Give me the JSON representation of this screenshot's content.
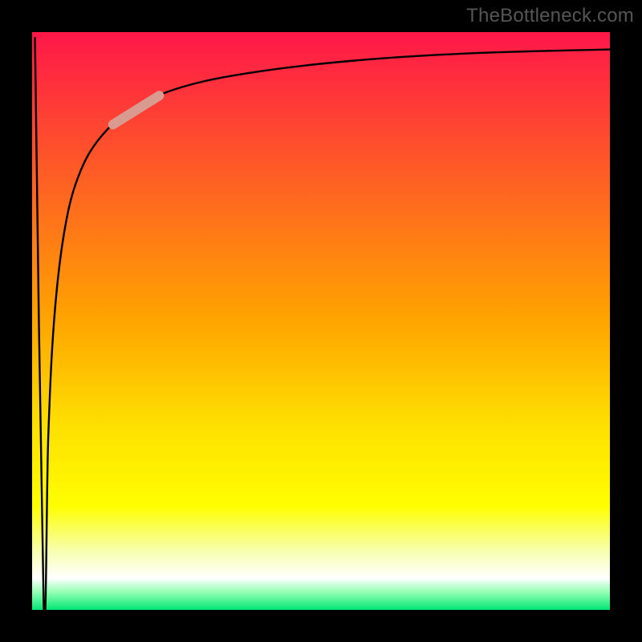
{
  "watermark": "TheBottleneck.com",
  "chart_data": {
    "type": "line",
    "title": "",
    "xlabel": "",
    "ylabel": "",
    "xlim": [
      0,
      100
    ],
    "ylim": [
      0,
      100
    ],
    "grid": false,
    "background_gradient": {
      "stops": [
        {
          "offset": 0,
          "color": "#fe1749"
        },
        {
          "offset": 0.5,
          "color": "#ffa500"
        },
        {
          "offset": 0.68,
          "color": "#fedf00"
        },
        {
          "offset": 0.82,
          "color": "#fffe00"
        },
        {
          "offset": 0.9,
          "color": "#f7ffb3"
        },
        {
          "offset": 0.945,
          "color": "#ffffff"
        },
        {
          "offset": 0.97,
          "color": "#90ffb0"
        },
        {
          "offset": 1,
          "color": "#00e676"
        }
      ]
    },
    "series": [
      {
        "name": "bottleneck-curve",
        "points": [
          {
            "x": 0.5,
            "y": 99.0
          },
          {
            "x": 2.0,
            "y": 1.0
          },
          {
            "x": 2.8,
            "y": 30.0
          },
          {
            "x": 3.8,
            "y": 50.0
          },
          {
            "x": 5.5,
            "y": 65.0
          },
          {
            "x": 8.0,
            "y": 75.0
          },
          {
            "x": 12.0,
            "y": 82.0
          },
          {
            "x": 18.0,
            "y": 87.0
          },
          {
            "x": 26.0,
            "y": 90.5
          },
          {
            "x": 38.0,
            "y": 93.0
          },
          {
            "x": 55.0,
            "y": 95.0
          },
          {
            "x": 75.0,
            "y": 96.3
          },
          {
            "x": 100.0,
            "y": 97.0
          }
        ]
      },
      {
        "name": "highlight-segment",
        "stroke": "#d99a90",
        "points": [
          {
            "x": 14.0,
            "y": 84.0
          },
          {
            "x": 22.0,
            "y": 89.0
          }
        ]
      }
    ]
  }
}
